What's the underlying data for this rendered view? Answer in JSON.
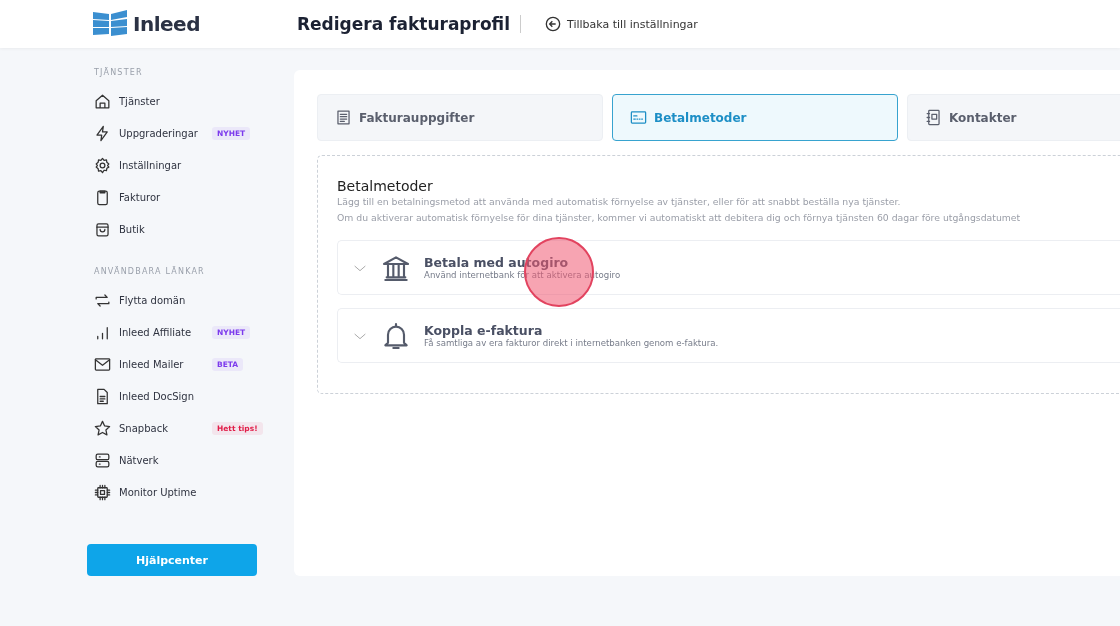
{
  "header": {
    "logo": "Inleed",
    "title": "Redigera fakturaprofil",
    "back_link": "Tillbaka till inställningar"
  },
  "sidebar": {
    "sections": [
      {
        "heading": "TJÄNSTER",
        "items": [
          {
            "kind": "home",
            "label": "Tjänster"
          },
          {
            "kind": "bolt",
            "label": "Uppgraderingar",
            "badge": {
              "text": "NYHET",
              "color": "#7c3aed"
            }
          },
          {
            "kind": "gear",
            "label": "Inställningar"
          },
          {
            "kind": "clipboard",
            "label": "Fakturor"
          },
          {
            "kind": "bag",
            "label": "Butik"
          }
        ]
      },
      {
        "heading": "ANVÄNDBARA LÄNKAR",
        "items": [
          {
            "kind": "arrows",
            "label": "Flytta domän"
          },
          {
            "kind": "bars",
            "label": "Inleed Affiliate",
            "badge": {
              "text": "NYHET",
              "color": "#7c3aed"
            }
          },
          {
            "kind": "mail",
            "label": "Inleed Mailer",
            "badge": {
              "text": "BETA",
              "color": "#7c3aed"
            }
          },
          {
            "kind": "doc",
            "label": "Inleed DocSign"
          },
          {
            "kind": "star",
            "label": "Snapback",
            "badge": {
              "text": "Hett tips!",
              "color": "#e11d48"
            }
          },
          {
            "kind": "server",
            "label": "Nätverk"
          },
          {
            "kind": "chip",
            "label": "Monitor Uptime"
          }
        ]
      }
    ],
    "help_button": "Hjälpcenter"
  },
  "tabs": [
    {
      "kind": "receipt",
      "label": "Fakturauppgifter",
      "selected": false
    },
    {
      "kind": "card",
      "label": "Betalmetoder",
      "selected": true
    },
    {
      "kind": "contacts",
      "label": "Kontakter",
      "selected": false
    }
  ],
  "panel": {
    "title": "Betalmetoder",
    "description": [
      "Lägg till en betalningsmetod att använda med automatisk förnyelse av tjänster, eller för att snabbt beställa nya tjänster.",
      "Om du aktiverar automatisk förnyelse för dina tjänster, kommer vi automatiskt att debitera dig och förnya tjänsten 60 dagar före utgångsdatumet"
    ],
    "methods": [
      {
        "kind": "bank",
        "title": "Betala med autogiro",
        "subtitle": "Använd internetbank för att aktivera autogiro",
        "expanded": false
      },
      {
        "kind": "bell",
        "title": "Koppla e-faktura",
        "subtitle": "Få samtliga av era fakturor direkt i internetbanken genom e-faktura.",
        "expanded": false
      }
    ]
  }
}
